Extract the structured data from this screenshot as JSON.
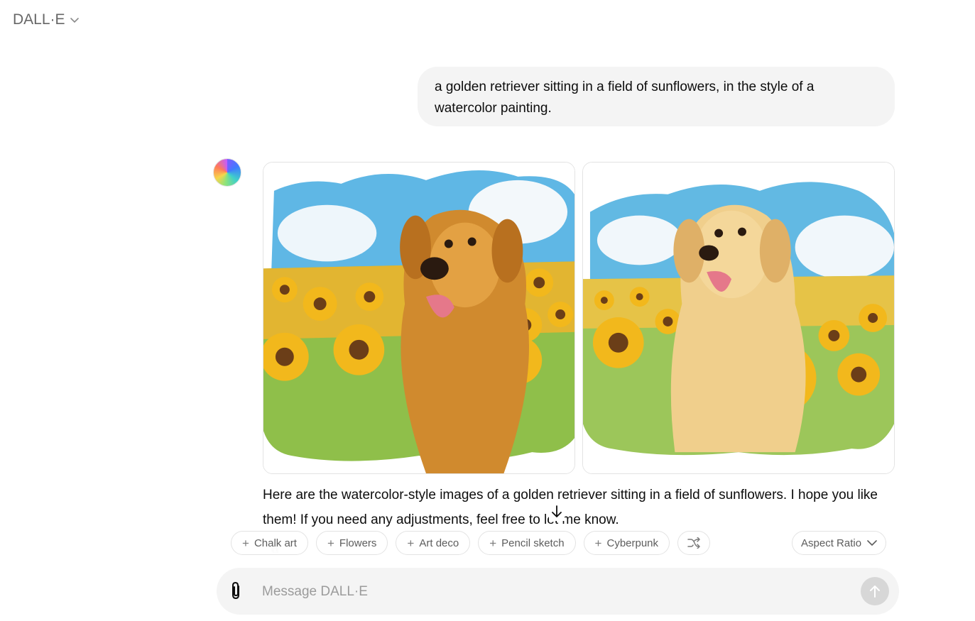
{
  "header": {
    "model_name": "DALL·E"
  },
  "conversation": {
    "user_message": "a golden retriever sitting in a field of sunflowers, in the style of a watercolor painting.",
    "assistant_reply": "Here are the watercolor-style images of a golden retriever sitting in a field of sunflowers. I hope you like them! If you need any adjustments, feel free to let me know.",
    "images": [
      {
        "icon": "watercolor-golden-retriever-sunflowers-image"
      },
      {
        "icon": "watercolor-golden-retriever-sunflowers-image"
      }
    ]
  },
  "style_chips": [
    {
      "label": "Chalk art"
    },
    {
      "label": "Flowers"
    },
    {
      "label": "Art deco"
    },
    {
      "label": "Pencil sketch"
    },
    {
      "label": "Cyberpunk"
    }
  ],
  "aspect_ratio": {
    "label": "Aspect Ratio"
  },
  "composer": {
    "placeholder": "Message DALL·E"
  },
  "colors": {
    "user_bubble": "#f4f4f4",
    "composer_bg": "#f4f4f4",
    "send_button_disabled": "#d7d7d7",
    "chip_text": "#5d5d5d"
  }
}
